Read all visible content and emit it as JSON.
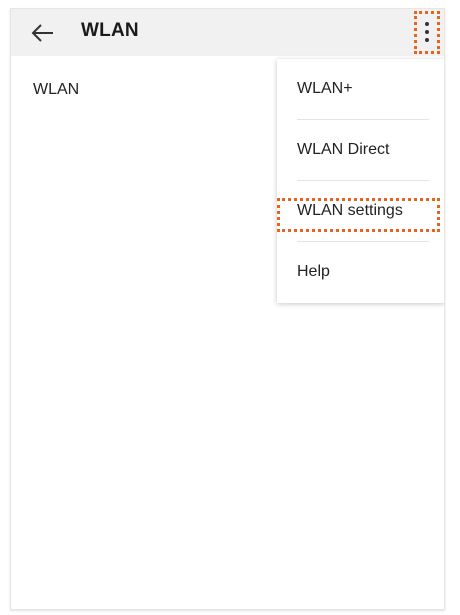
{
  "appbar": {
    "back_icon": "arrow-left-icon",
    "title": "WLAN",
    "more_icon": "more-vertical-icon"
  },
  "content": {
    "label": "WLAN"
  },
  "menu": {
    "items": [
      {
        "label": "WLAN+"
      },
      {
        "label": "WLAN Direct"
      },
      {
        "label": "WLAN settings"
      },
      {
        "label": "Help"
      }
    ]
  },
  "colors": {
    "appbar_bg": "#f1f1f1",
    "annotation_highlight": "#e8641c",
    "text": "#222222"
  }
}
